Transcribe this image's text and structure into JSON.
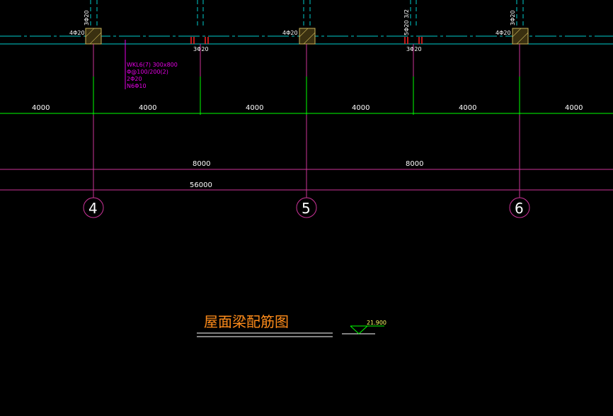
{
  "colors": {
    "background": "#000000",
    "beam_line": "#00cccc",
    "axis_line": "#cc3399",
    "dim_line": "#00ff00",
    "annotation": "#e600e6",
    "title": "#ff8c1a",
    "elevation": "#ffff66",
    "column_fill": "#c8b45a",
    "rebar_mark": "#ff2222"
  },
  "top_rebar_labels": {
    "left_col": "4Φ20",
    "left_col_vertical": "3Φ20",
    "mid_col": "4Φ20",
    "mid_col_vertical": "3Φ20",
    "right_col": "4Φ20",
    "right_col_vertical": "3Φ20",
    "span_bottom_1": "3Φ20",
    "span_bottom_2": "3Φ20",
    "span_top_2": "5Φ20 3/2"
  },
  "beam_annotation": {
    "line1": "WKL6(7) 300x800",
    "line2": "Φ@100/200(2)",
    "line3": "2Φ20",
    "line4": "N6Φ10"
  },
  "dimensions": {
    "row1": [
      "4000",
      "4000",
      "4000",
      "4000",
      "4000",
      "4000"
    ],
    "row2": [
      "8000",
      "8000"
    ],
    "row3": "56000"
  },
  "axes": [
    "4",
    "5",
    "6"
  ],
  "drawing_title": "屋面梁配筋图",
  "elevation": "21.900"
}
